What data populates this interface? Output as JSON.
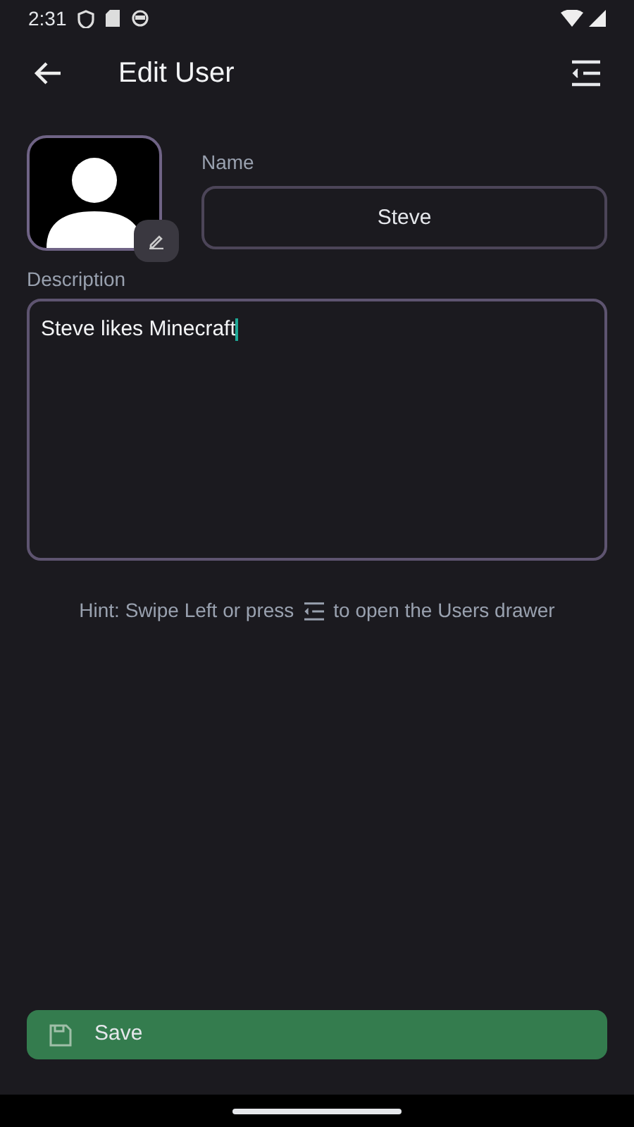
{
  "status_bar": {
    "time": "2:31"
  },
  "app_bar": {
    "title": "Edit User"
  },
  "name_field": {
    "label": "Name",
    "value": "Steve"
  },
  "description_field": {
    "label": "Description",
    "value": "Steve likes Minecraft",
    "focused": true
  },
  "hint": {
    "before": "Hint: Swipe Left or press",
    "after": "to open the Users drawer"
  },
  "save_button": {
    "label": "Save"
  }
}
